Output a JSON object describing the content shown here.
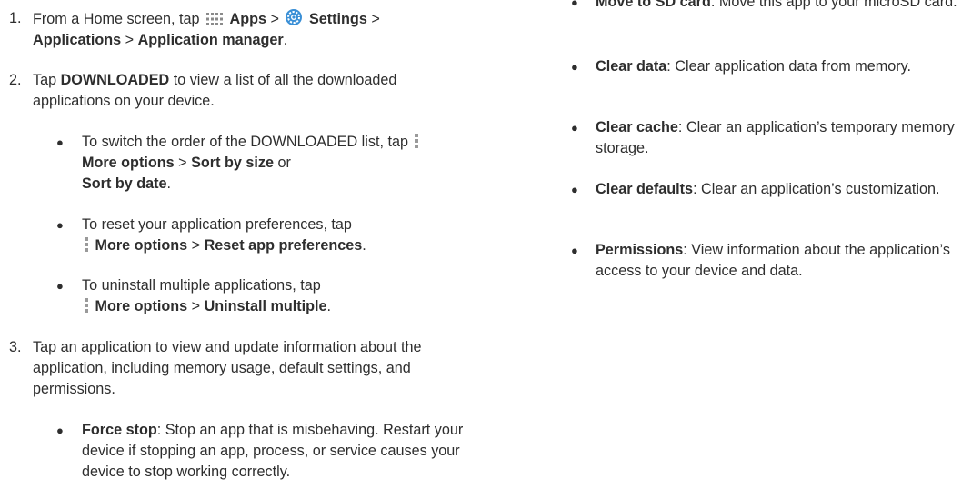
{
  "steps": [
    {
      "num": "1.",
      "pre": "From a Home screen, tap",
      "apps_label": "Apps",
      "sep1": ">",
      "settings_label": "Settings",
      "sep2": ">",
      "applications_label": "Applications",
      "sep3": ">",
      "app_manager_label": "Application manager",
      "end": "."
    },
    {
      "num": "2.",
      "pre": "Tap",
      "downloaded_label": "DOWNLOADED",
      "post": "to view a list of all the downloaded applications on your device.",
      "bullets": [
        {
          "pre": "To switch the order of the DOWNLOADED list, tap",
          "more_options": "More options",
          "sep": ">",
          "opt1": "Sort by size",
          "or": "or",
          "opt2": "Sort by date",
          "end": "."
        },
        {
          "pre": "To reset your application preferences, tap",
          "more_options": "More options",
          "sep": ">",
          "opt1": "Reset app preferences",
          "end": "."
        },
        {
          "pre": "To uninstall multiple applications, tap",
          "more_options": "More options",
          "sep": ">",
          "opt1": "Uninstall multiple",
          "end": "."
        }
      ]
    },
    {
      "num": "3.",
      "text": "Tap an application to view and update information about the application, including memory usage, default settings, and permissions.",
      "bullets": [
        {
          "term": "Force stop",
          "desc": ": Stop an app that is misbehaving. Restart your device if stopping an app, process, or service causes your device to stop working correctly."
        }
      ]
    }
  ],
  "right_bullets": [
    {
      "term": "Move to SD card",
      "desc": ": Move this app to your microSD card."
    },
    {
      "term": "Clear data",
      "desc": ": Clear application data from memory."
    },
    {
      "term": "Clear cache",
      "desc": ": Clear an application’s temporary memory storage."
    },
    {
      "term": "Clear defaults",
      "desc": ": Clear an application’s customization."
    },
    {
      "term": "Permissions",
      "desc": ": View information about the application’s access to your device and data."
    }
  ],
  "bullet_char": "●",
  "icons": {
    "apps": "apps-grid-icon",
    "settings": "settings-gear-icon",
    "more_options": "more-options-icon"
  },
  "colors": {
    "text": "#2e2e2e",
    "settings_icon": "#3a8fd6",
    "apps_icon": "#8a8a8a"
  }
}
